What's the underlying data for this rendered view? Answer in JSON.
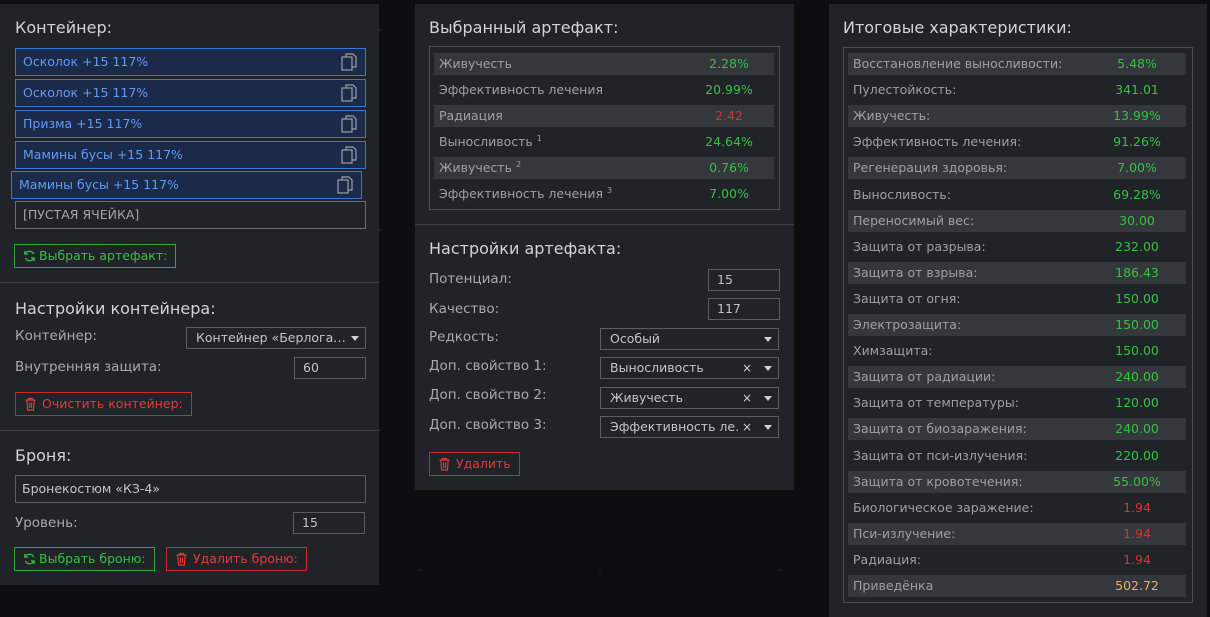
{
  "container": {
    "title": "Контейнер:",
    "slots": [
      {
        "label": "Осколок +15 117%"
      },
      {
        "label": "Осколок +15 117%"
      },
      {
        "label": "Призма +15 117%"
      },
      {
        "label": "Мамины бусы +15 117%"
      },
      {
        "label": "Мамины бусы +15 117%"
      }
    ],
    "empty_slot": "[ПУСТАЯ ЯЧЕЙКА]",
    "select_artifact_btn": "Выбрать артефакт:"
  },
  "container_settings": {
    "title": "Настройки контейнера:",
    "container_label": "Контейнер:",
    "container_value": "Контейнер «Берлога…",
    "internal_protection_label": "Внутренняя защита:",
    "internal_protection_value": "60",
    "clear_btn": "Очистить контейнер:"
  },
  "armor": {
    "title": "Броня:",
    "armor_value": "Бронекостюм «КЗ-4»",
    "level_label": "Уровень:",
    "level_value": "15",
    "select_btn": "Выбрать броню:",
    "delete_btn": "Удалить броню:"
  },
  "selected_artifact": {
    "title": "Выбранный артефакт:",
    "stats": [
      {
        "name": "Живучесть",
        "sup": "",
        "value": "2.28%",
        "color": "#35c142"
      },
      {
        "name": "Эффективность лечения",
        "sup": "",
        "value": "20.99%",
        "color": "#35c142"
      },
      {
        "name": "Радиация",
        "sup": "",
        "value": "2.42",
        "color": "#d8332f"
      },
      {
        "name": "Выносливость",
        "sup": "1",
        "value": "24.64%",
        "color": "#35c142"
      },
      {
        "name": "Живучесть",
        "sup": "2",
        "value": "0.76%",
        "color": "#35c142"
      },
      {
        "name": "Эффективность лечения",
        "sup": "3",
        "value": "7.00%",
        "color": "#35c142"
      }
    ]
  },
  "artifact_settings": {
    "title": "Настройки артефакта:",
    "potential_label": "Потенциал:",
    "potential_value": "15",
    "quality_label": "Качество:",
    "quality_value": "117",
    "rarity_label": "Редкость:",
    "rarity_value": "Особый",
    "extra1_label": "Доп. свойство 1:",
    "extra1_value": "Выносливость",
    "extra2_label": "Доп. свойство 2:",
    "extra2_value": "Живучесть",
    "extra3_label": "Доп. свойство 3:",
    "extra3_value": "Эффективность ле…",
    "delete_btn": "Удалить"
  },
  "totals": {
    "title": "Итоговые характеристики:",
    "stats": [
      {
        "name": "Восстановление выносливости:",
        "value": "5.48%",
        "color": "#35c142"
      },
      {
        "name": "Пулестойкость:",
        "value": "341.01",
        "color": "#35c142"
      },
      {
        "name": "Живучесть:",
        "value": "13.99%",
        "color": "#35c142"
      },
      {
        "name": "Эффективность лечения:",
        "value": "91.26%",
        "color": "#35c142"
      },
      {
        "name": "Регенерация здоровья:",
        "value": "7.00%",
        "color": "#35c142"
      },
      {
        "name": "Выносливость:",
        "value": "69.28%",
        "color": "#35c142"
      },
      {
        "name": "Переносимый вес:",
        "value": "30.00",
        "color": "#35c142"
      },
      {
        "name": "Защита от разрыва:",
        "value": "232.00",
        "color": "#35c142"
      },
      {
        "name": "Защита от взрыва:",
        "value": "186.43",
        "color": "#35c142"
      },
      {
        "name": "Защита от огня:",
        "value": "150.00",
        "color": "#35c142"
      },
      {
        "name": "Электрозащита:",
        "value": "150.00",
        "color": "#35c142"
      },
      {
        "name": "Химзащита:",
        "value": "150.00",
        "color": "#35c142"
      },
      {
        "name": "Защита от радиации:",
        "value": "240.00",
        "color": "#35c142"
      },
      {
        "name": "Защита от температуры:",
        "value": "120.00",
        "color": "#35c142"
      },
      {
        "name": "Защита от биозаражения:",
        "value": "240.00",
        "color": "#35c142"
      },
      {
        "name": "Защита от пси-излучения:",
        "value": "220.00",
        "color": "#35c142"
      },
      {
        "name": "Защита от кровотечения:",
        "value": "55.00%",
        "color": "#35c142"
      },
      {
        "name": "Биологическое заражение:",
        "value": "1.94",
        "color": "#d8332f"
      },
      {
        "name": "Пси-излучение:",
        "value": "1.94",
        "color": "#d8332f"
      },
      {
        "name": "Радиация:",
        "value": "1.94",
        "color": "#d8332f"
      },
      {
        "name": "Приведёнка",
        "value": "502.72",
        "color": "#e2b84a"
      }
    ]
  }
}
